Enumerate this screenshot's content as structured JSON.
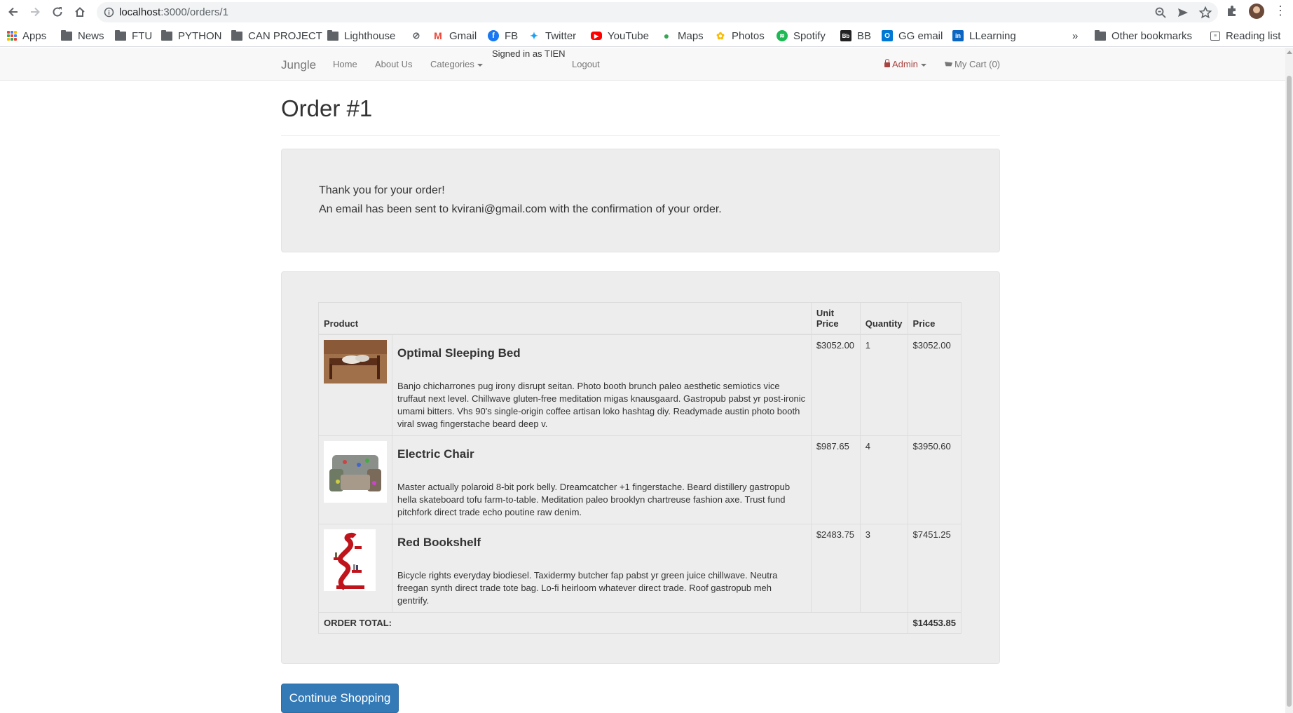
{
  "browser": {
    "url_host": "localhost",
    "url_path": ":3000/orders/1",
    "bookmarks": [
      {
        "label": "Apps",
        "icon": "apps-grid-icon"
      },
      {
        "label": "News",
        "icon": "folder-icon"
      },
      {
        "label": "FTU",
        "icon": "folder-icon"
      },
      {
        "label": "PYTHON",
        "icon": "folder-icon"
      },
      {
        "label": "CAN PROJECT",
        "icon": "folder-icon"
      },
      {
        "label": "Lighthouse",
        "icon": "folder-icon"
      },
      {
        "label": "",
        "icon": "link-icon"
      },
      {
        "label": "Gmail",
        "icon": "gmail-icon"
      },
      {
        "label": "FB",
        "icon": "facebook-icon"
      },
      {
        "label": "Twitter",
        "icon": "twitter-icon"
      },
      {
        "label": "YouTube",
        "icon": "youtube-icon"
      },
      {
        "label": "Maps",
        "icon": "maps-icon"
      },
      {
        "label": "Photos",
        "icon": "photos-icon"
      },
      {
        "label": "Spotify",
        "icon": "spotify-icon"
      },
      {
        "label": "BB",
        "icon": "bb-icon"
      },
      {
        "label": "GG email",
        "icon": "outlook-icon"
      },
      {
        "label": "LLearning",
        "icon": "linkedin-icon"
      }
    ],
    "more_bookmarks": "»",
    "other_bookmarks": "Other bookmarks",
    "reading_list": "Reading list"
  },
  "nav": {
    "brand": "Jungle",
    "home": "Home",
    "about": "About Us",
    "categories": "Categories",
    "signed_in": "Signed in as TIEN",
    "logout": "Logout",
    "admin": "Admin",
    "cart": "My Cart (0)"
  },
  "order": {
    "title": "Order #1",
    "thanks_line1": "Thank you for your order!",
    "thanks_line2": "An email has been sent to kvirani@gmail.com with the confirmation of your order.",
    "headers": {
      "product": "Product",
      "unit_price": "Unit Price",
      "quantity": "Quantity",
      "price": "Price"
    },
    "items": [
      {
        "name": "Optimal Sleeping Bed",
        "description": "Banjo chicharrones pug irony disrupt seitan. Photo booth brunch paleo aesthetic semiotics vice truffaut next level. Chillwave gluten-free meditation migas knausgaard. Gastropub pabst yr post-ironic umami bitters. Vhs 90's single-origin coffee artisan loko hashtag diy. Readymade austin photo booth viral swag fingerstache beard deep v.",
        "unit_price": "$3052.00",
        "quantity": "1",
        "price": "$3052.00"
      },
      {
        "name": "Electric Chair",
        "description": "Master actually polaroid 8-bit pork belly. Dreamcatcher +1 fingerstache. Beard distillery gastropub hella skateboard tofu farm-to-table. Meditation paleo brooklyn chartreuse fashion axe. Trust fund pitchfork direct trade echo poutine raw denim.",
        "unit_price": "$987.65",
        "quantity": "4",
        "price": "$3950.60"
      },
      {
        "name": "Red Bookshelf",
        "description": "Bicycle rights everyday biodiesel. Taxidermy butcher fap pabst yr green juice chillwave. Neutra freegan synth direct trade tote bag. Lo-fi heirloom whatever direct trade. Roof gastropub meh gentrify.",
        "unit_price": "$2483.75",
        "quantity": "3",
        "price": "$7451.25"
      }
    ],
    "total_label": "ORDER TOTAL:",
    "total_value": "$14453.85",
    "continue_label": "Continue Shopping"
  }
}
